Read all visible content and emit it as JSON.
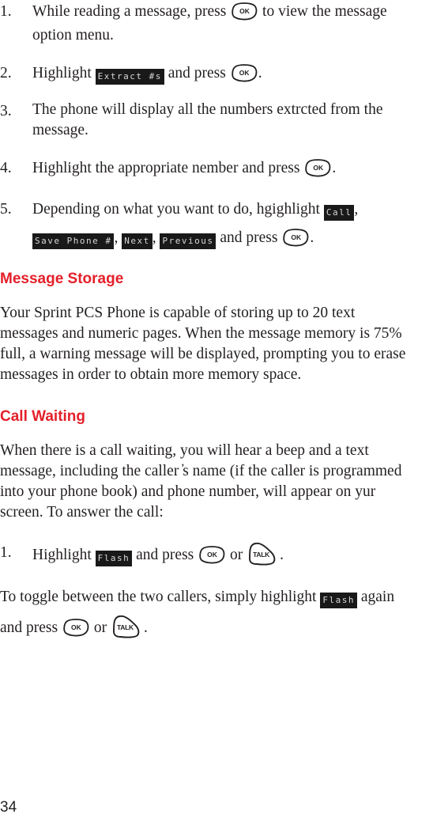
{
  "buttons": {
    "ok": "OK",
    "talk": "TALK"
  },
  "steps_top": [
    {
      "number": "1.",
      "line1_before": "While reading a message, press",
      "line1_after": "to view the message",
      "line2": "option menu."
    },
    {
      "number": "2.",
      "before": "Highlight",
      "lcd": "Extract #s",
      "after": "and press",
      "end": "."
    },
    {
      "number": "3.",
      "line1": "The phone will display all the numbers extrcted from the",
      "line2": "message."
    },
    {
      "number": "4.",
      "before": "Highlight the appropriate nember and press",
      "end": "."
    },
    {
      "number": "5.",
      "line1_before": "Depending on what you want to do, hgighlight",
      "lcd_call": "Call",
      "comma": ",",
      "lcd_save": "Save Phone #",
      "lcd_next": "Next",
      "lcd_previous": "Previous",
      "after": "and press",
      "end": "."
    }
  ],
  "sections": {
    "message_storage": {
      "heading": "Message Storage",
      "lines": [
        "Your Sprint PCS Phone is capable of storing up to 20 text",
        "messages and numeric pages. When the message memory is 75%",
        "full, a warning message will be displayed, prompting you to erase",
        "messages in order to obtain more memory space."
      ]
    },
    "call_waiting": {
      "heading": "Call Waiting",
      "lines": [
        "When there is a call waiting, you will hear a beep and a text",
        "message, including the caller ̓s name (if the caller is programmed",
        "into your phone book) and phone number, will appear on yur",
        "screen. To answer the call:"
      ],
      "step": {
        "number": "1.",
        "before": "Highlight",
        "lcd": "Flash",
        "after": "and press",
        "or": "or",
        "end": "."
      },
      "toggle": {
        "line1_before": "To toggle between the two callers, simply highlight",
        "lcd": "Flash",
        "line1_after": "again",
        "line2_before": "and press",
        "or": "or",
        "end": "."
      }
    }
  },
  "page_number": "34"
}
